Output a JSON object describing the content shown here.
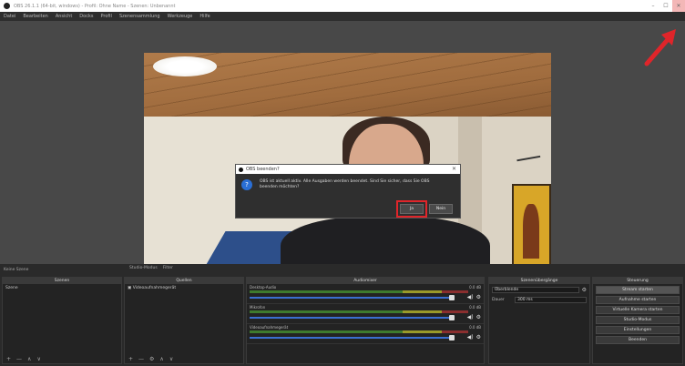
{
  "window": {
    "title": "OBS 26.1.1 (64-bit, windows) - Profil: Ohne Name - Szenen: Unbenannt",
    "minimize": "–",
    "maximize": "☐",
    "close": "✕"
  },
  "menu": [
    "Datei",
    "Bearbeiten",
    "Ansicht",
    "Docks",
    "Profil",
    "Szenensammlung",
    "Werkzeuge",
    "Hilfe"
  ],
  "dialog": {
    "title": "OBS beenden?",
    "message": "OBS ist aktuell aktiv. Alle Ausgaben werden beendet. Sind Sie sicher, dass Sie OBS beenden möchten?",
    "yes": "Ja",
    "no": "Nein",
    "icon": "?"
  },
  "scene_bar": {
    "label": "Keine Szene",
    "studio_mode": "Studio-Modus",
    "filter": "Filter"
  },
  "docks": {
    "scenes": {
      "title": "Szenen",
      "items": [
        "Szene"
      ]
    },
    "sources": {
      "title": "Quellen",
      "items": [
        "Videoaufnahmegerät"
      ]
    },
    "mixer": {
      "title": "Audiomixer",
      "tracks": [
        {
          "name": "Desktop-Audio",
          "db": "0.0 dB"
        },
        {
          "name": "Mikrofon",
          "db": "0.0 dB"
        },
        {
          "name": "Videoaufnahmegerät",
          "db": "0.0 dB"
        }
      ]
    },
    "transitions": {
      "title": "Szenenübergänge",
      "type": "Überblende",
      "duration_label": "Dauer",
      "duration": "300 ms"
    },
    "controls": {
      "title": "Steuerung",
      "buttons": [
        "Stream starten",
        "Aufnahme starten",
        "Virtuelle Kamera starten",
        "Studio-Modus",
        "Einstellungen",
        "Beenden"
      ]
    }
  },
  "footer_icons": {
    "add": "+",
    "remove": "—",
    "up": "∧",
    "down": "∨",
    "gear": "⚙"
  }
}
